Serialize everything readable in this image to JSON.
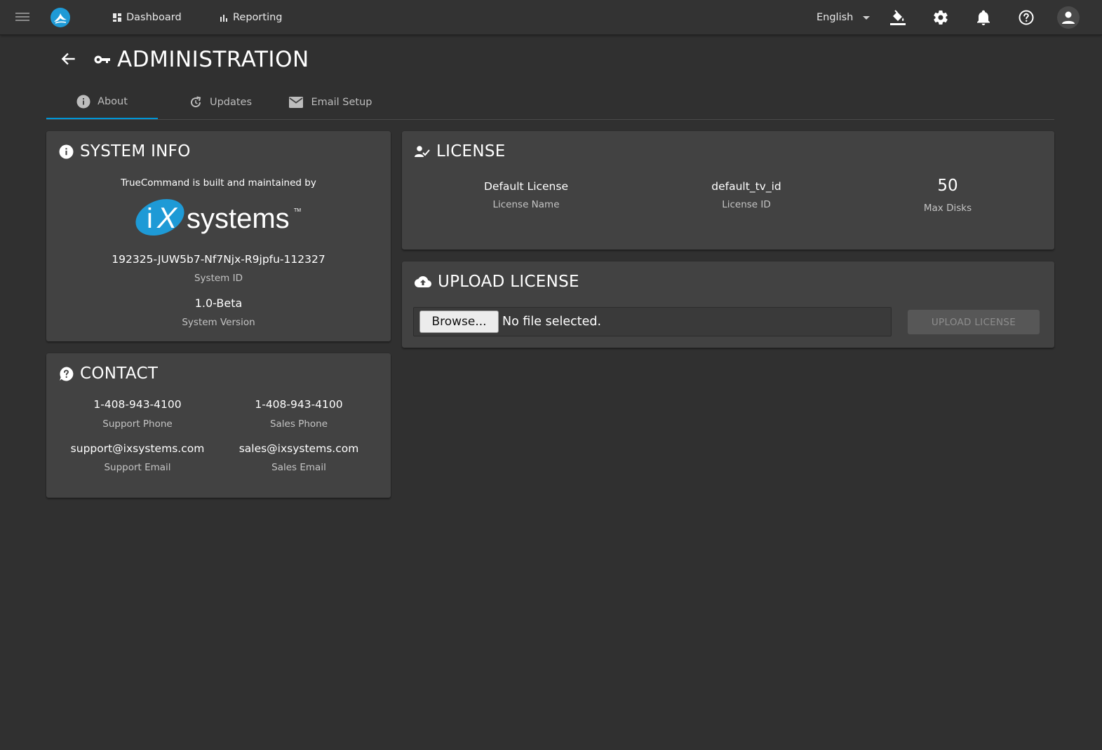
{
  "topbar": {
    "nav": [
      {
        "label": "Dashboard",
        "icon": "dashboard-icon"
      },
      {
        "label": "Reporting",
        "icon": "bar-chart-icon"
      }
    ],
    "language": "English",
    "icons": [
      "paint-bucket-icon",
      "gear-icon",
      "bell-icon",
      "help-icon",
      "account-icon"
    ]
  },
  "header": {
    "title": "ADMINISTRATION",
    "icon": "key-icon"
  },
  "tabs": [
    {
      "label": "About",
      "icon": "info-icon",
      "active": true
    },
    {
      "label": "Updates",
      "icon": "refresh-icon",
      "active": false
    },
    {
      "label": "Email Setup",
      "icon": "mail-icon",
      "active": false
    }
  ],
  "system_info": {
    "title": "SYSTEM INFO",
    "maintained_by": "TrueCommand is built and maintained by",
    "logo_text": "iX systems",
    "system_id": "192325-JUW5b7-Nf7Njx-R9jpfu-112327",
    "system_id_label": "System ID",
    "version": "1.0-Beta",
    "version_label": "System Version"
  },
  "contact": {
    "title": "CONTACT",
    "support_phone": "1-408-943-4100",
    "support_phone_label": "Support Phone",
    "sales_phone": "1-408-943-4100",
    "sales_phone_label": "Sales Phone",
    "support_email": "support@ixsystems.com",
    "support_email_label": "Support Email",
    "sales_email": "sales@ixsystems.com",
    "sales_email_label": "Sales Email"
  },
  "license": {
    "title": "LICENSE",
    "name": "Default License",
    "name_label": "License Name",
    "id": "default_tv_id",
    "id_label": "License ID",
    "max_disks": "50",
    "max_disks_label": "Max Disks"
  },
  "upload": {
    "title": "UPLOAD LICENSE",
    "browse_label": "Browse...",
    "file_status": "No file selected.",
    "button_label": "UPLOAD LICENSE"
  },
  "colors": {
    "background": "#303030",
    "card": "#424242",
    "accent": "#0095d5",
    "ix_blue": "#1e9ad6"
  }
}
